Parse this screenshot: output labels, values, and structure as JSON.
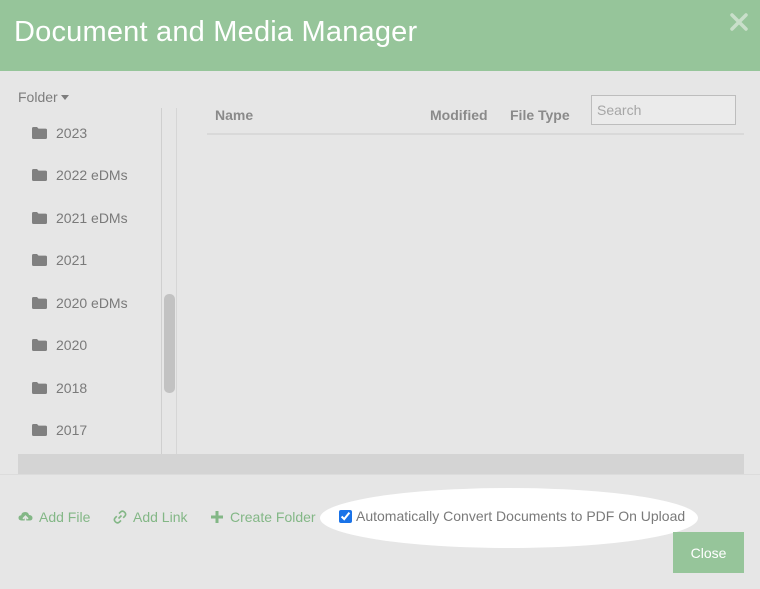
{
  "dialog": {
    "title": "Document and Media Manager",
    "close_icon": "close-x-icon"
  },
  "sidebar": {
    "folder_label": "Folder",
    "folders": [
      {
        "label": "2023",
        "icon": "folder-icon"
      },
      {
        "label": "2022 eDMs",
        "icon": "folder-icon"
      },
      {
        "label": "2021 eDMs",
        "icon": "folder-icon"
      },
      {
        "label": "2021",
        "icon": "folder-icon"
      },
      {
        "label": "2020 eDMs",
        "icon": "folder-icon"
      },
      {
        "label": "2020",
        "icon": "folder-icon"
      },
      {
        "label": "2018",
        "icon": "folder-icon"
      },
      {
        "label": "2017",
        "icon": "folder-icon"
      }
    ]
  },
  "files": {
    "columns": {
      "name": "Name",
      "modified": "Modified",
      "type": "File Type"
    },
    "search": {
      "placeholder": "Search",
      "value": ""
    }
  },
  "footer": {
    "add_file": "Add File",
    "add_link": "Add Link",
    "create_folder": "Create Folder",
    "convert_label": "Automatically Convert Documents to PDF On Upload",
    "convert_checked": true,
    "close": "Close"
  },
  "colors": {
    "accent": "#96c59a",
    "action_text": "#83b786",
    "background": "#e6e6e6"
  }
}
